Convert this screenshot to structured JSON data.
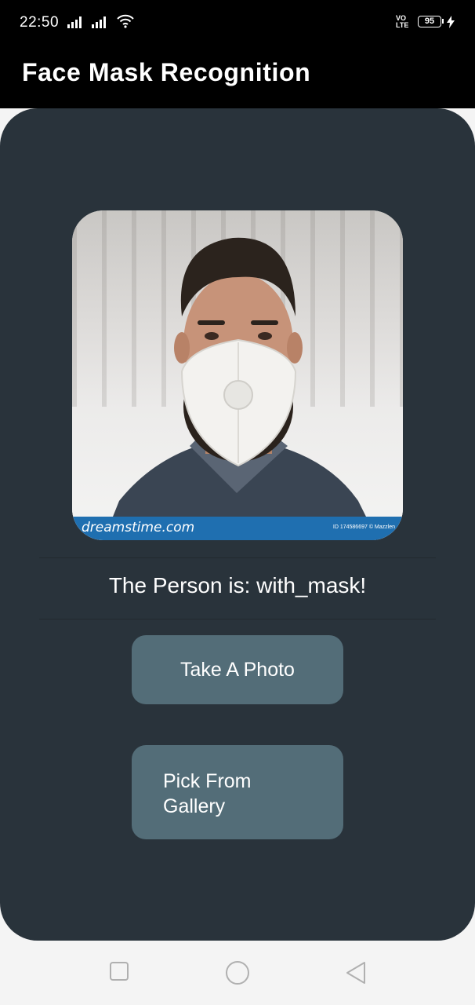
{
  "status_bar": {
    "time": "22:50",
    "volte": "VO\nLTE",
    "battery": "95"
  },
  "app_bar": {
    "title": "Face Mask Recognition"
  },
  "photo": {
    "watermark_brand": "dreamstime.com",
    "watermark_id": "ID 174586697 © Mazzlen"
  },
  "result": {
    "text": "The Person is: with_mask!"
  },
  "buttons": {
    "take_photo": "Take A Photo",
    "pick_gallery": "Pick From Gallery"
  },
  "colors": {
    "card": "#29333b",
    "button": "#536d78",
    "app_bar": "#000000"
  },
  "icons": {
    "nav": [
      "square-icon",
      "circle-icon",
      "triangle-back-icon"
    ]
  }
}
